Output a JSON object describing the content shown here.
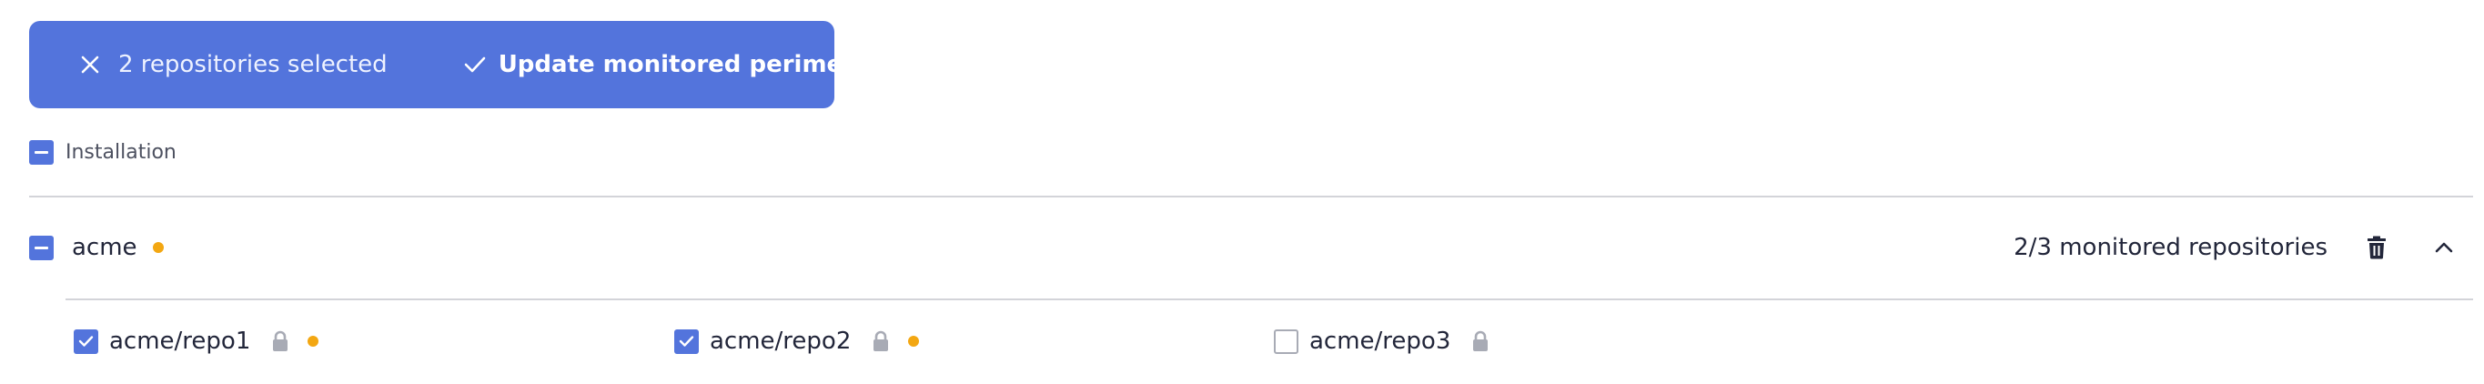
{
  "selection_bar": {
    "count_label": "2 repositories selected",
    "update_label": "Update monitored perimeter",
    "icons": {
      "close": "close-icon",
      "update": "check-icon"
    },
    "background": "#5374dc"
  },
  "installation": {
    "label": "Installation",
    "checkbox_state": "indeterminate"
  },
  "organization": {
    "name": "acme",
    "checkbox_state": "indeterminate",
    "status_dot_color": "#f3a712",
    "monitored_label": "2/3 monitored repositories",
    "icons": {
      "delete": "trash-icon",
      "collapse": "chevron-up-icon"
    }
  },
  "repositories": [
    {
      "name": "acme/repo1",
      "checked": true,
      "private": true,
      "status_dot": true
    },
    {
      "name": "acme/repo2",
      "checked": true,
      "private": true,
      "status_dot": true
    },
    {
      "name": "acme/repo3",
      "checked": false,
      "private": true,
      "status_dot": false
    }
  ],
  "colors": {
    "accent": "#5374dc",
    "warning_dot": "#f3a712",
    "divider": "#d3d4d9",
    "text": "#22263a"
  }
}
